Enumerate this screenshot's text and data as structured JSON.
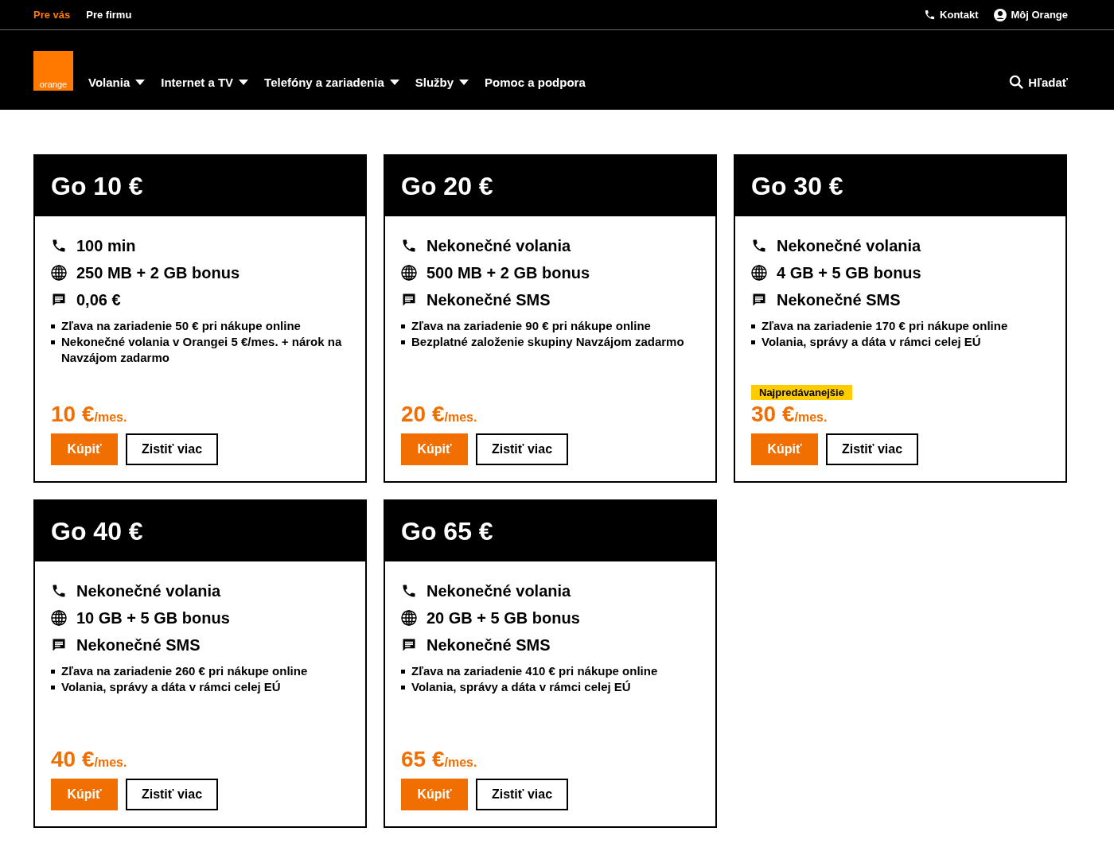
{
  "top_bar": {
    "segments": [
      {
        "label": "Pre vás",
        "selected": true
      },
      {
        "label": "Pre firmu",
        "selected": false
      }
    ],
    "links": [
      {
        "kind": "phone",
        "label": "Kontakt"
      },
      {
        "kind": "user",
        "label": "Môj Orange"
      }
    ]
  },
  "nav": {
    "logo": "orange",
    "items": [
      {
        "label": "Volania",
        "has_menu": true
      },
      {
        "label": "Internet a TV",
        "has_menu": true
      },
      {
        "label": "Telefóny a zariadenia",
        "has_menu": true
      },
      {
        "label": "Služby",
        "has_menu": true
      },
      {
        "label": "Pomoc a podpora",
        "has_menu": false
      }
    ],
    "search": "Hľadať"
  },
  "plans": [
    {
      "title": "Go 10 €",
      "features": [
        {
          "kind": "call",
          "text": "100 min"
        },
        {
          "kind": "data",
          "text": "250 MB + 2 GB bonus"
        },
        {
          "kind": "sms",
          "text": "0,06 €"
        }
      ],
      "benefits": [
        "Zľava na zariadenie 50 € pri nákupe online",
        "Nekonečné volania v Orangei 5 €/mes. + nárok na Navzájom zadarmo"
      ],
      "price": "10 €",
      "unit": "/mes.",
      "buy": "Kúpiť",
      "more": "Zistiť viac"
    },
    {
      "title": "Go 20 €",
      "features": [
        {
          "kind": "call",
          "text": "Nekonečné volania"
        },
        {
          "kind": "data",
          "text": "500 MB + 2 GB bonus"
        },
        {
          "kind": "sms",
          "text": "Nekonečné SMS"
        }
      ],
      "benefits": [
        "Zľava na zariadenie 90 € pri nákupe online",
        "Bezplatné založenie skupiny Navzájom zadarmo"
      ],
      "price": "20 €",
      "unit": "/mes.",
      "buy": "Kúpiť",
      "more": "Zistiť viac"
    },
    {
      "title": "Go 30 €",
      "features": [
        {
          "kind": "call",
          "text": "Nekonečné volania"
        },
        {
          "kind": "data",
          "text": "4 GB + 5 GB bonus"
        },
        {
          "kind": "sms",
          "text": "Nekonečné SMS"
        }
      ],
      "benefits": [
        "Zľava na zariadenie 170 € pri nákupe online",
        "Volania, správy a dáta v rámci celej EÚ"
      ],
      "badge": "Najpredávanejšie",
      "price": "30 €",
      "unit": "/mes.",
      "buy": "Kúpiť",
      "more": "Zistiť viac"
    },
    {
      "title": "Go 40 €",
      "features": [
        {
          "kind": "call",
          "text": "Nekonečné volania"
        },
        {
          "kind": "data",
          "text": "10 GB + 5 GB bonus"
        },
        {
          "kind": "sms",
          "text": "Nekonečné SMS"
        }
      ],
      "benefits": [
        "Zľava na zariadenie 260 € pri nákupe online",
        "Volania, správy a dáta v rámci celej EÚ"
      ],
      "price": "40 €",
      "unit": "/mes.",
      "buy": "Kúpiť",
      "more": "Zistiť viac"
    },
    {
      "title": "Go 65 €",
      "features": [
        {
          "kind": "call",
          "text": "Nekonečné volania"
        },
        {
          "kind": "data",
          "text": "20 GB + 5 GB bonus"
        },
        {
          "kind": "sms",
          "text": "Nekonečné SMS"
        }
      ],
      "benefits": [
        "Zľava na zariadenie 410 € pri nákupe online",
        "Volania, správy a dáta v rámci celej EÚ"
      ],
      "price": "65 €",
      "unit": "/mes.",
      "buy": "Kúpiť",
      "more": "Zistiť viac"
    }
  ]
}
